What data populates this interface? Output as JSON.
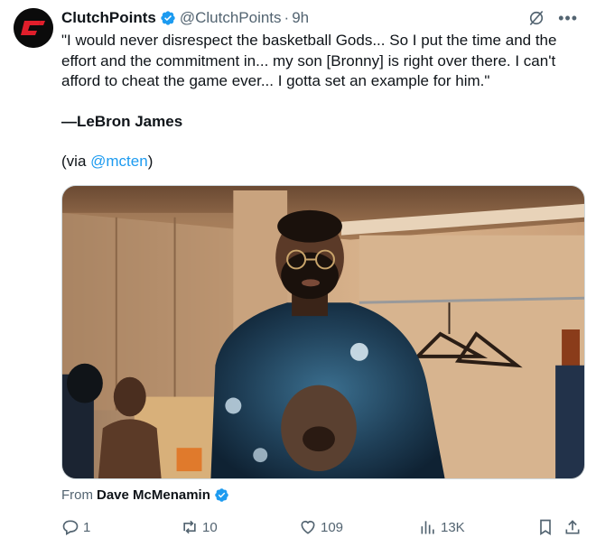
{
  "author": {
    "name": "ClutchPoints",
    "handle": "@ClutchPoints",
    "separator": "·",
    "time": "9h"
  },
  "tweet": {
    "quote": "\"I would never disrespect the basketball Gods... So I put the time and the effort and the commitment in... my son [Bronny] is right over there. I can't afford to cheat the game ever... I gotta set an example for him.\"",
    "attribution": "—LeBron James",
    "via_prefix": "(via ",
    "via_mention": "@mcten",
    "via_suffix": ")"
  },
  "media": {
    "subject": "video-still-man-in-hoodie-interview",
    "from_label": "From",
    "from_name": "Dave McMenamin"
  },
  "actions": {
    "replies": "1",
    "reposts": "10",
    "likes": "109",
    "views": "13K"
  },
  "icons": {
    "avatar": "clutchpoints-logo",
    "verified": "verified-badge-icon",
    "grok": "grok-icon",
    "more": "more-icon",
    "reply": "reply-icon",
    "repost": "repost-icon",
    "like": "like-icon",
    "views": "views-icon",
    "bookmark": "bookmark-icon",
    "share": "share-icon"
  },
  "colors": {
    "accent": "#1d9bf0",
    "muted": "#536471",
    "text": "#0f1419",
    "brand_red": "#e01e2b"
  }
}
